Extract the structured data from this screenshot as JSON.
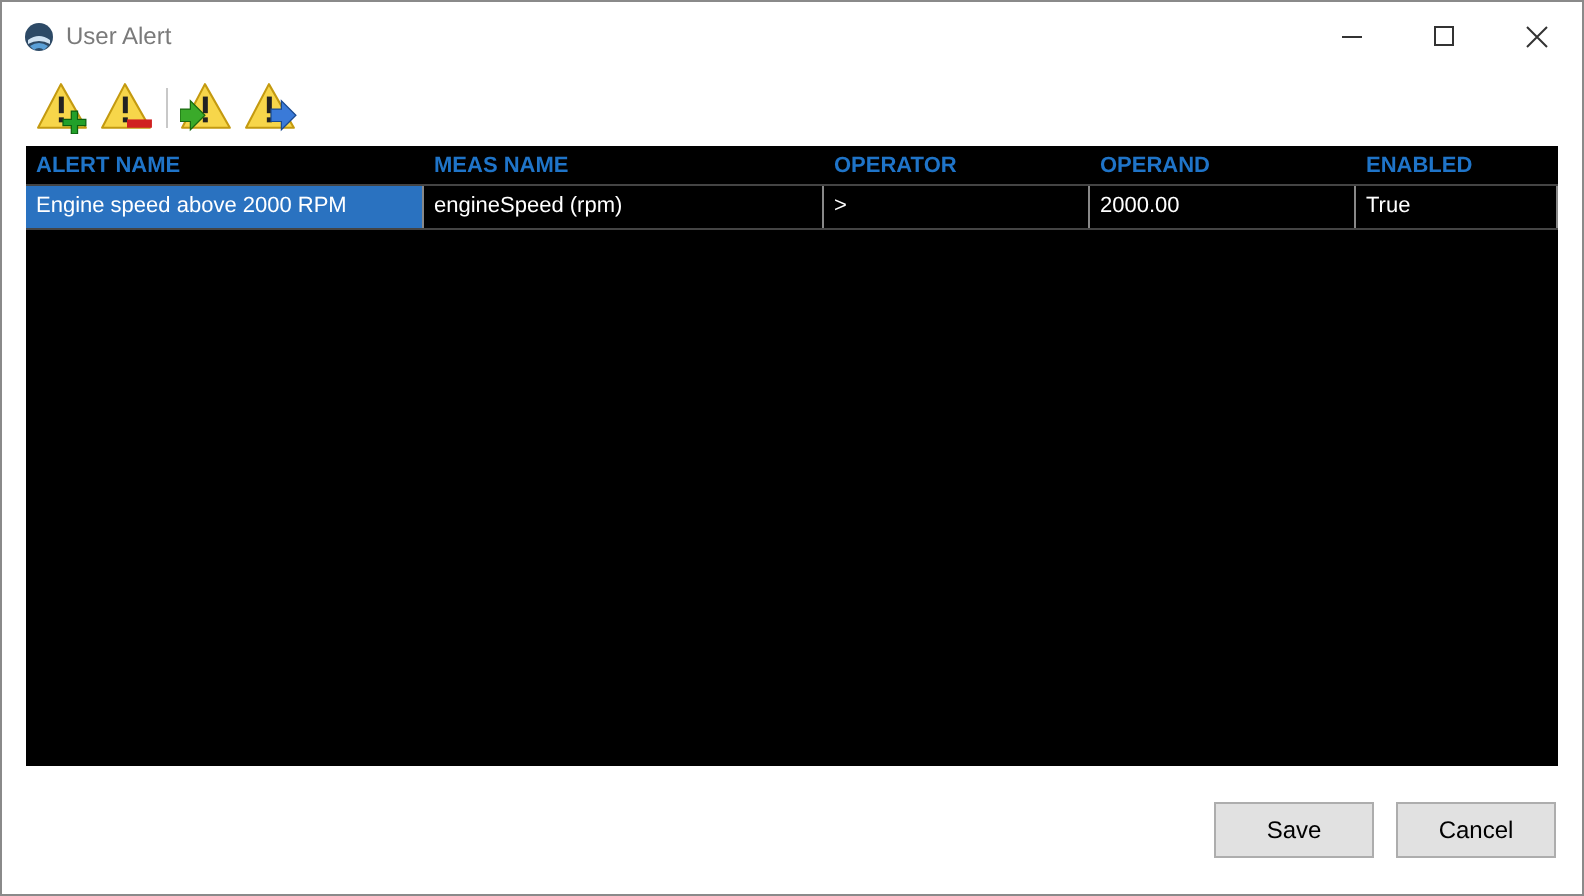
{
  "window": {
    "title": "User Alert"
  },
  "toolbar": [
    {
      "kind": "add"
    },
    {
      "kind": "remove"
    },
    {
      "kind": "separator"
    },
    {
      "kind": "import"
    },
    {
      "kind": "export"
    }
  ],
  "table": {
    "columns": [
      "ALERT NAME",
      "MEAS NAME",
      "OPERATOR",
      "OPERAND",
      "ENABLED"
    ],
    "rows": [
      {
        "selected": true,
        "cells": [
          "Engine speed above 2000 RPM",
          "engineSpeed (rpm)",
          ">",
          "2000.00",
          "True"
        ]
      }
    ]
  },
  "buttons": [
    "Save",
    "Cancel"
  ]
}
